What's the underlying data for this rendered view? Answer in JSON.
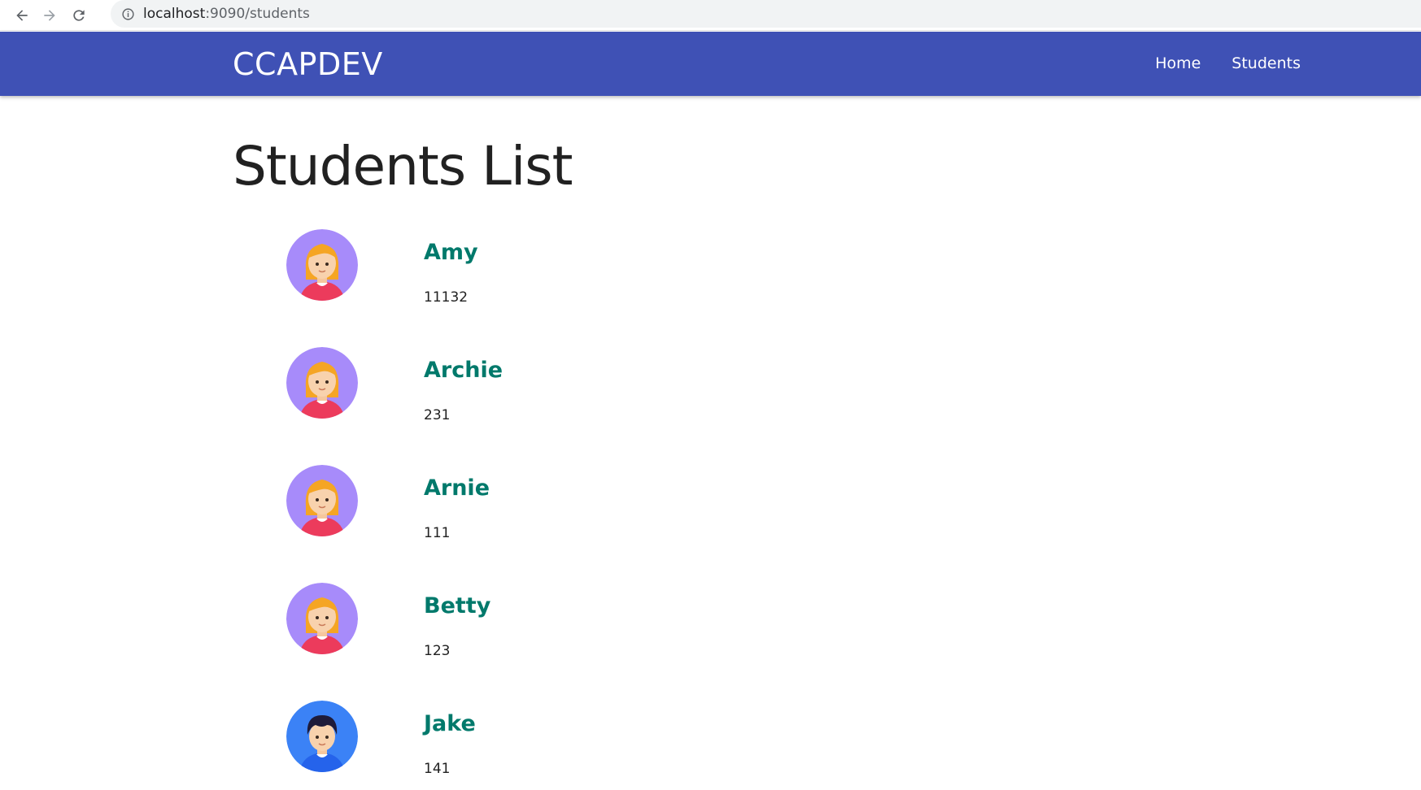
{
  "browser": {
    "url_host": "localhost",
    "url_path": ":9090/students"
  },
  "navbar": {
    "brand": "CCAPDEV",
    "color": "#3f51b5",
    "links": [
      {
        "label": "Home"
      },
      {
        "label": "Students"
      }
    ]
  },
  "main": {
    "title": "Students List"
  },
  "students": [
    {
      "name": "Amy",
      "id": "11132",
      "avatar": "female-avatar-icon"
    },
    {
      "name": "Archie",
      "id": "231",
      "avatar": "female-avatar-icon"
    },
    {
      "name": "Arnie",
      "id": "111",
      "avatar": "female-avatar-icon"
    },
    {
      "name": "Betty",
      "id": "123",
      "avatar": "female-avatar-icon"
    },
    {
      "name": "Jake",
      "id": "141",
      "avatar": "male-avatar-icon"
    }
  ],
  "colors": {
    "name_accent": "#00796b",
    "female_avatar_bg": "#a78bfa",
    "male_avatar_bg": "#3b82f6"
  }
}
